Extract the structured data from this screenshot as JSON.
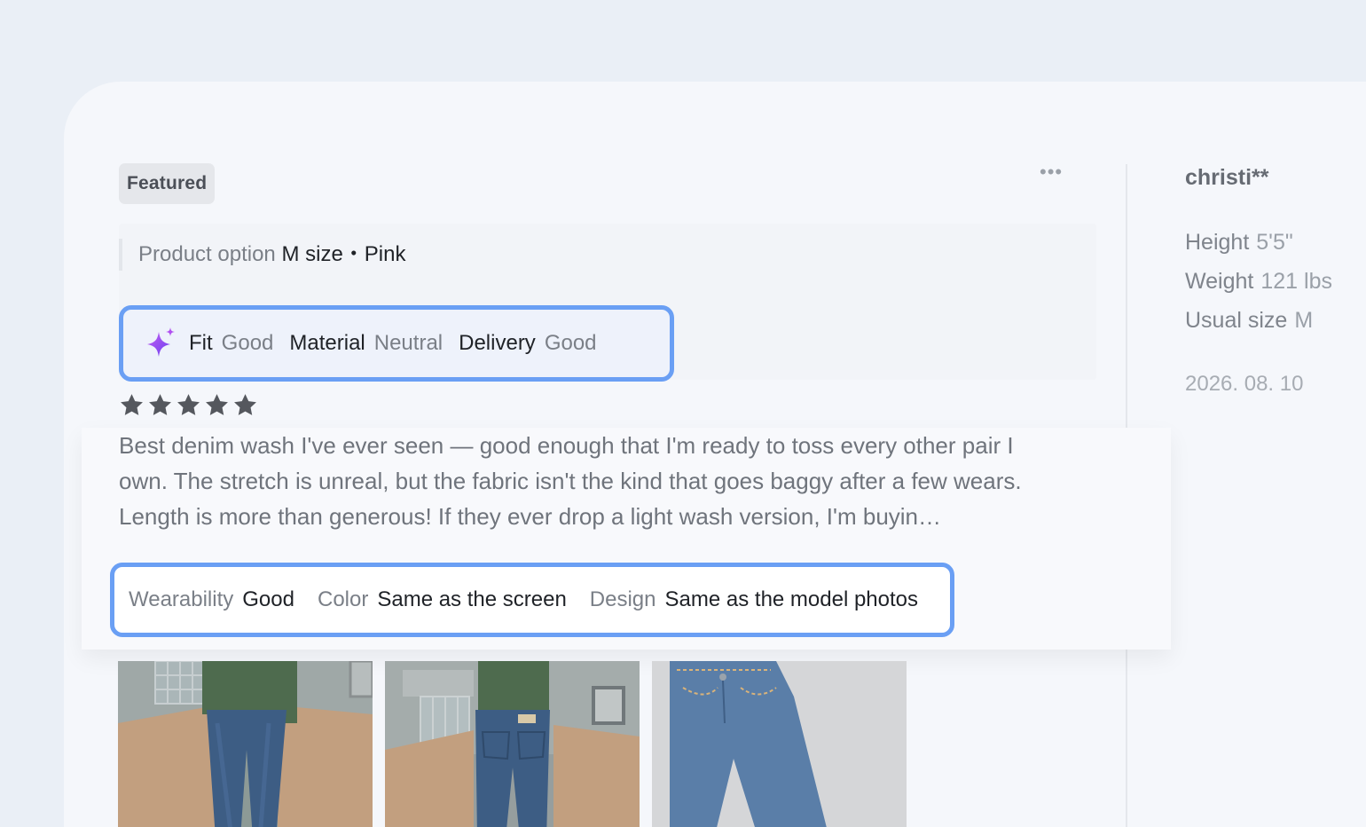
{
  "review": {
    "badge": "Featured",
    "more_label": "•••",
    "product_option": {
      "label": "Product option",
      "value": "M size・Pink"
    },
    "quick_tags": [
      {
        "key": "Fit",
        "value": "Good"
      },
      {
        "key": "Material",
        "value": "Neutral"
      },
      {
        "key": "Delivery",
        "value": "Good"
      }
    ],
    "rating": 5,
    "rating_max": 5,
    "text": "Best denim wash I've ever seen — good enough that I'm ready to toss every other pair I own. The stretch is unreal, but the fabric isn't the kind that goes baggy after a few wears. Length is more than generous! If they ever drop a light wash version, I'm buyin…",
    "attributes": [
      {
        "key": "Wearability",
        "value": "Good"
      },
      {
        "key": "Color",
        "value": "Same as the screen"
      },
      {
        "key": "Design",
        "value": "Same as the model photos"
      }
    ],
    "photos": [
      "photo-front-view",
      "photo-back-view",
      "photo-flat-lay"
    ]
  },
  "reviewer": {
    "name": "christi**",
    "height_label": "Height",
    "height_value": "5'5\"",
    "weight_label": "Weight",
    "weight_value": "121 lbs",
    "size_label": "Usual size",
    "size_value": "M",
    "date": "2026. 08. 10"
  },
  "colors": {
    "highlight_border": "#6a9ff4",
    "background": "#eaeff6",
    "card": "#f5f7fb",
    "star": "#55585e"
  }
}
